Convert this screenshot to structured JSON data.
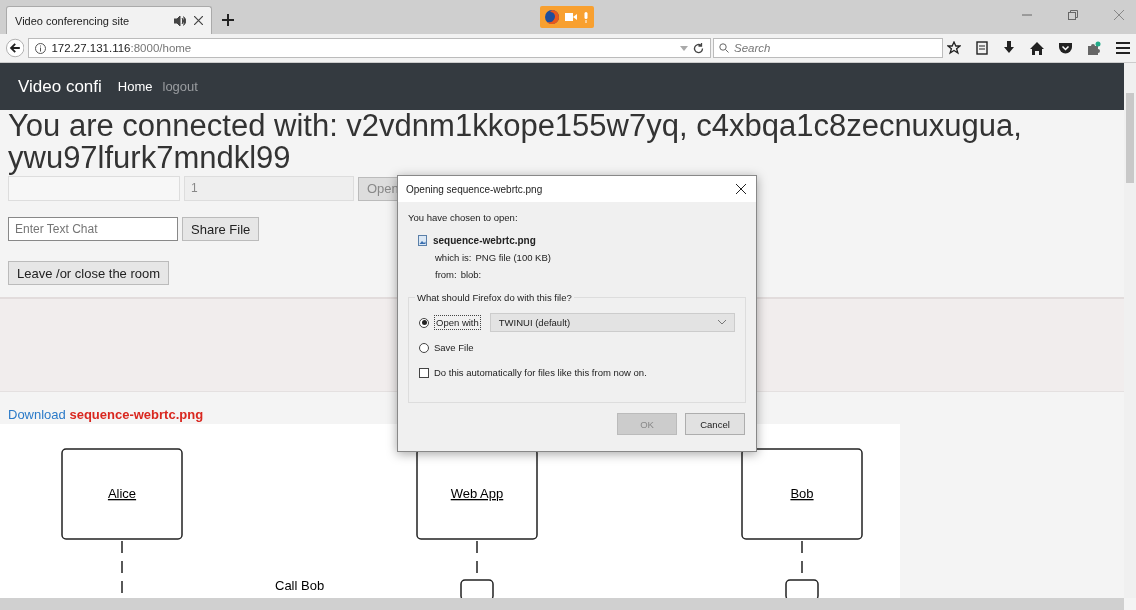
{
  "browser": {
    "tabs": [
      {
        "title": "Video conferencing site",
        "selected": true
      }
    ],
    "url": {
      "host": "172.27.131.116",
      "path": ":8000/home"
    },
    "search": {
      "placeholder": "Search"
    }
  },
  "navbar": {
    "brand": "Video confi",
    "links": [
      {
        "label": "Home",
        "selected": true
      },
      {
        "label": "logout",
        "selected": false
      }
    ]
  },
  "heading": "You are connected with: v2vdnm1kkope155w7yq, c4xbqa1c8zecnuxugua, ywu97lfurk7mndkl99",
  "room": {
    "count_field": {
      "value": "1"
    },
    "open_button": "Open",
    "chat": {
      "placeholder": "Enter Text Chat"
    },
    "share_button": "Share File",
    "leave_button": "Leave /or close the room"
  },
  "download": {
    "label": "Download",
    "file": "sequence-webrtc.png"
  },
  "diagram": {
    "participants": [
      "Alice",
      "Web App",
      "Bob"
    ],
    "messages": [
      "Call Bob"
    ]
  },
  "dialog": {
    "title": "Opening sequence-webrtc.png",
    "intro": "You have chosen to open:",
    "file_name": "sequence-webrtc.png",
    "type_label": "which is:",
    "type": "PNG file (100 KB)",
    "from_label": "from:",
    "from": "blob:",
    "group": "What should Firefox do with this file?",
    "options": [
      {
        "label": "Open with",
        "selected": true
      },
      {
        "label": "Save File",
        "selected": false
      }
    ],
    "app": "TWINUI (default)",
    "auto": {
      "label": "Do this automatically for files like this from now on.",
      "checked": false
    },
    "buttons": [
      {
        "label": "OK",
        "disabled": true
      },
      {
        "label": "Cancel",
        "disabled": false
      }
    ]
  }
}
